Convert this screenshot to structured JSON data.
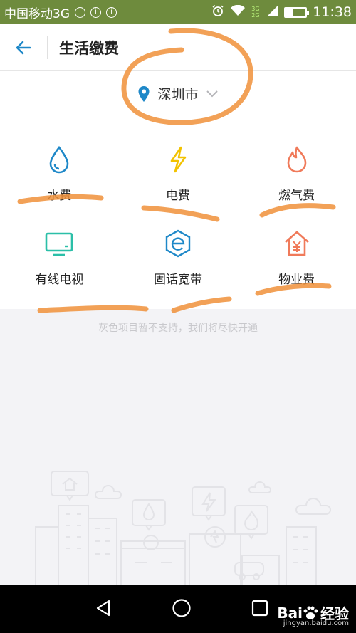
{
  "status_bar": {
    "carrier": "中国移动3G",
    "indicators": [
      "i",
      "i",
      "i"
    ],
    "time": "11:38",
    "network": "3G 2G",
    "battery_level": 0.3,
    "icons": [
      "alarm-icon",
      "wifi-icon",
      "signal-icon",
      "battery-icon"
    ]
  },
  "header": {
    "title": "生活缴费",
    "back_icon": "back-arrow-icon"
  },
  "city_selector": {
    "city": "深圳市",
    "icon": "location-pin-icon",
    "dropdown_icon": "chevron-down-icon"
  },
  "services": [
    {
      "label": "水费",
      "icon": "water-drop-icon",
      "color": "#1e88c8"
    },
    {
      "label": "电费",
      "icon": "lightning-icon",
      "color": "#f2c200"
    },
    {
      "label": "燃气费",
      "icon": "flame-icon",
      "color": "#f07a5a"
    },
    {
      "label": "有线电视",
      "icon": "tv-icon",
      "color": "#2bbfa8"
    },
    {
      "label": "固话宽带",
      "icon": "broadband-icon",
      "color": "#1e88c8"
    },
    {
      "label": "物业费",
      "icon": "house-yen-icon",
      "color": "#f07a5a"
    }
  ],
  "notice": "灰色项目暂不支持，我们将尽快开通",
  "nav_bar": {
    "icons": [
      "back-triangle-icon",
      "home-circle-icon",
      "recents-square-icon"
    ]
  },
  "watermark": {
    "brand": "Bai",
    "brand_suffix": "经验",
    "url": "jingyan.baidu.com"
  },
  "colors": {
    "status_bar": "#6e8b3d",
    "accent": "#1e88c8",
    "annotation": "#f0913a"
  }
}
